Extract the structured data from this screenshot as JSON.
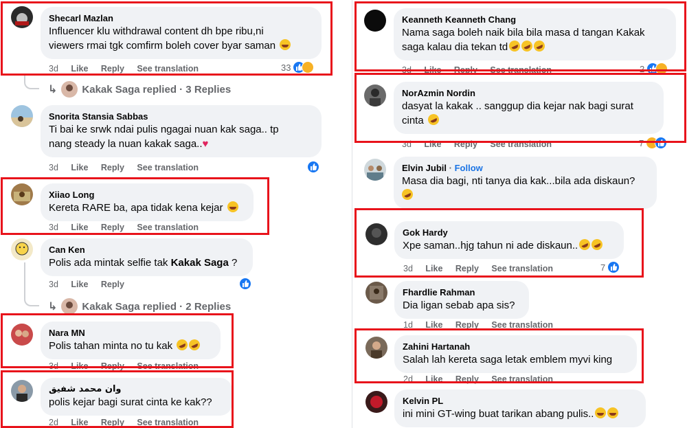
{
  "actions": {
    "like": "Like",
    "reply": "Reply",
    "translate": "See translation"
  },
  "left_comments": [
    {
      "name": "Shecarl Mazlan",
      "lines": [
        "Influencer klu withdrawal content dh bpe ribu,ni",
        "viewers rmai tgk comfirm boleh cover byar saman"
      ],
      "time": "3d",
      "reaction_count": "33"
    },
    {
      "name": "Snorita Stansia Sabbas",
      "lines": [
        "Ti bai ke srwk ndai pulis ngagai nuan kak saga.. tp",
        "nang steady la nuan kakak saga.."
      ],
      "time": "3d"
    },
    {
      "name": "Xiiao Long",
      "lines": [
        "Kereta RARE ba, apa tidak kena kejar"
      ],
      "time": "3d"
    },
    {
      "name": "Can Ken",
      "line_prefix": "Polis ada mintak selfie tak ",
      "line_bold": "Kakak Saga",
      "line_suffix": " ?",
      "time": "3d"
    },
    {
      "name": "Nara MN",
      "lines": [
        "Polis tahan minta no tu kak"
      ],
      "time": "3d"
    },
    {
      "name": "وان محمد شفيق",
      "lines": [
        "polis kejar bagi surat cinta ke kak??"
      ],
      "time": "2d"
    }
  ],
  "left_replies": [
    {
      "text": "Kakak Saga replied · 3 Replies"
    },
    {
      "text": "Kakak Saga replied · 2 Replies"
    }
  ],
  "right_comments": [
    {
      "name": "Keanneth Keanneth Chang",
      "lines": [
        "Nama saga boleh naik bila bila masa d tangan Kakak",
        "saga kalau dia tekan td"
      ],
      "time": "3d",
      "reaction_count": "2"
    },
    {
      "name": "NorAzmin Nordin",
      "lines": [
        "dasyat la kakak .. sanggup dia kejar nak bagi surat",
        "cinta"
      ],
      "time": "3d",
      "reaction_count": "7"
    },
    {
      "name": "Elvin Jubil",
      "follow_sep": "·",
      "follow": "Follow",
      "lines": [
        "Masa dia bagi, nti tanya dia kak...bila ada diskaun?",
        ""
      ],
      "time": ""
    },
    {
      "name": "Gok Hardy",
      "lines": [
        "Xpe saman..hjg tahun ni ade diskaun.."
      ],
      "time": "3d",
      "reaction_count": "7"
    },
    {
      "name": "Fhardlie Rahman",
      "lines": [
        "Dia ligan sebab apa sis?"
      ],
      "time": "1d"
    },
    {
      "name": "Zahini Hartanah",
      "lines": [
        "Salah lah kereta saga letak emblem myvi king"
      ],
      "time": "2d"
    },
    {
      "name": "Kelvin PL",
      "lines": [
        "ini mini GT-wing buat tarikan abang pulis.."
      ],
      "time": ""
    }
  ],
  "colors": {
    "highlight": "#e8131b",
    "bubble": "#f0f2f5",
    "like_blue": "#1877f2",
    "meta_gray": "#65676b",
    "follow_blue": "#1b74e4"
  }
}
